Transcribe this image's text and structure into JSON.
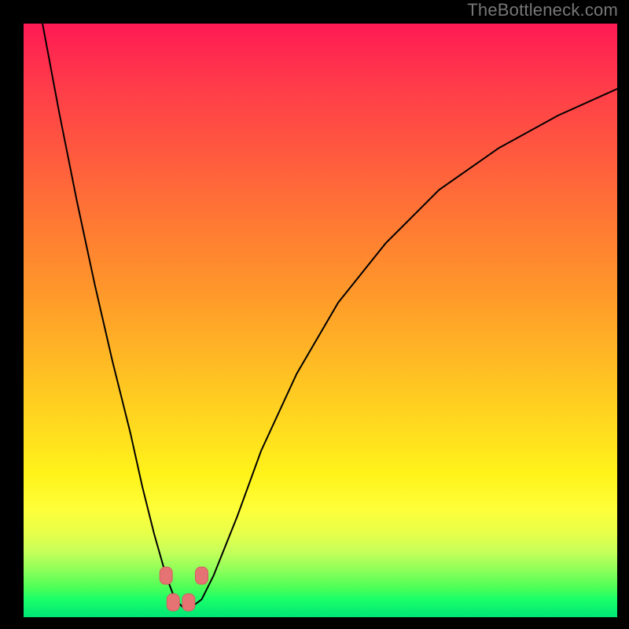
{
  "watermark": {
    "text": "TheBottleneck.com"
  },
  "colors": {
    "curve_stroke": "#000000",
    "marker_fill": "#e57373",
    "marker_stroke": "#d45f5f",
    "gradient_top": "#ff1a54",
    "gradient_bottom": "#00e676",
    "frame": "#000000"
  },
  "chart_data": {
    "type": "line",
    "title": "",
    "xlabel": "",
    "ylabel": "",
    "xlim": [
      0,
      100
    ],
    "ylim": [
      0,
      100
    ],
    "grid": false,
    "legend": false,
    "note": "No axis ticks or numeric labels are rendered; values are positional estimates (0–100) read from the plot area.",
    "series": [
      {
        "name": "bottleneck-curve",
        "x": [
          3,
          6,
          9,
          12,
          15,
          18,
          20,
          22,
          24,
          25.5,
          27,
          28,
          30,
          32,
          36,
          40,
          46,
          53,
          61,
          70,
          80,
          90,
          100
        ],
        "y": [
          101,
          85,
          70,
          56,
          43,
          31,
          22,
          14,
          7,
          3,
          1.5,
          1.5,
          3,
          7,
          17,
          28,
          41,
          53,
          63,
          72,
          79,
          84.5,
          89
        ]
      }
    ],
    "markers": [
      {
        "x": 24.0,
        "y": 7.0
      },
      {
        "x": 25.2,
        "y": 2.5
      },
      {
        "x": 27.8,
        "y": 2.5
      },
      {
        "x": 30.0,
        "y": 7.0
      }
    ],
    "minimum_region_x": [
      25.5,
      28.0
    ]
  }
}
